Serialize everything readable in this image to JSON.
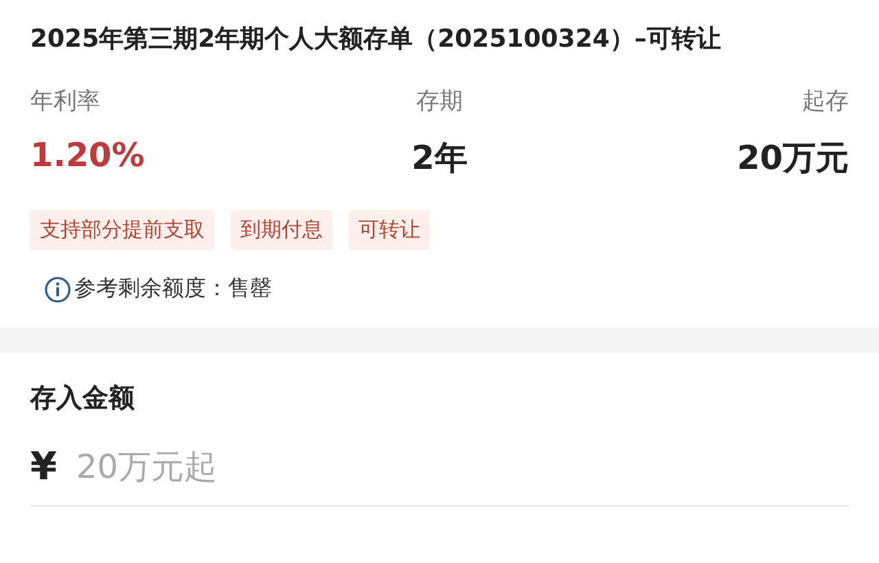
{
  "product": {
    "title": "2025年第三期2年期个人大额存单（2025100324）–可转让",
    "stats": [
      {
        "label": "年利率",
        "value": "1.20%",
        "kind": "rate"
      },
      {
        "label": "存期",
        "value": "2年",
        "kind": "plain"
      },
      {
        "label": "起存",
        "value": "20万元",
        "kind": "plain"
      }
    ],
    "tags": [
      "支持部分提前支取",
      "到期付息",
      "可转让"
    ],
    "quota": "参考剩余额度：售罄"
  },
  "deposit": {
    "title": "存入金额",
    "currency": "¥",
    "amount": {
      "placeholder": "20万元起"
    }
  }
}
